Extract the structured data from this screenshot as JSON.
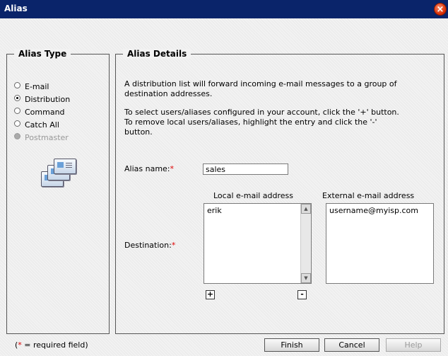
{
  "window": {
    "title": "Alias",
    "close_symbol": "×"
  },
  "alias_type": {
    "legend": "Alias Type",
    "options": [
      {
        "label": "E-mail",
        "checked": false,
        "disabled": false
      },
      {
        "label": "Distribution",
        "checked": true,
        "disabled": false
      },
      {
        "label": "Command",
        "checked": false,
        "disabled": false
      },
      {
        "label": "Catch All",
        "checked": false,
        "disabled": false
      },
      {
        "label": "Postmaster",
        "checked": false,
        "disabled": true
      }
    ],
    "icon": "address-cards-icon"
  },
  "alias_details": {
    "legend": "Alias Details",
    "desc_1": "A distribution list will forward incoming e-mail messages to a group of",
    "desc_2": "destination addresses.",
    "desc_3": "To select users/aliases configured in your account, click the '+' button.",
    "desc_4": "To remove local users/aliases, highlight the entry and click the '-'",
    "desc_5": "button.",
    "alias_name_label": "Alias name:",
    "alias_name_value": "sales",
    "required_mark": "*",
    "destination_label": "Destination:",
    "local_header": "Local e-mail address",
    "external_header": "External e-mail address",
    "local_items": [
      "erik"
    ],
    "external_value": "username@myisp.com",
    "add_symbol": "+",
    "remove_symbol": "-"
  },
  "footer": {
    "req_open": "(",
    "req_star": "*",
    "req_rest": " = required field)",
    "finish": "Finish",
    "cancel": "Cancel",
    "help": "Help"
  },
  "colors": {
    "titlebar": "#0a246a",
    "required": "#dd0000"
  }
}
